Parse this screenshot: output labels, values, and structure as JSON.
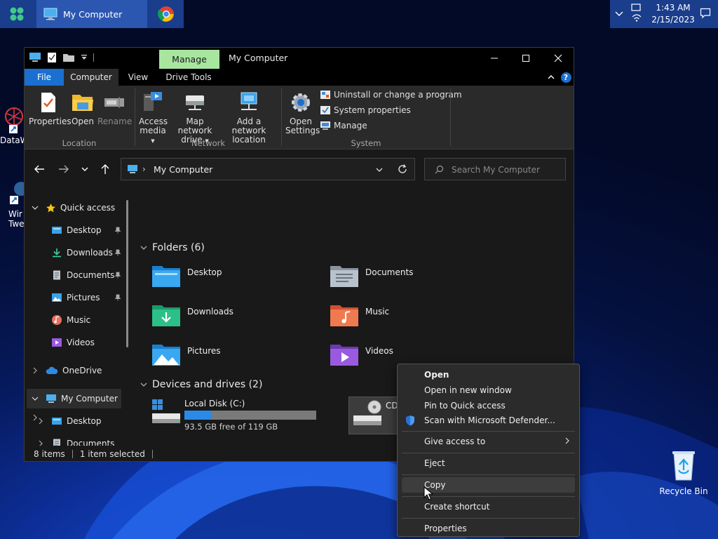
{
  "taskbar": {
    "start_label": "Start",
    "active_app": "My Computer",
    "time": "1:43 AM",
    "date": "2/15/2023"
  },
  "desktop": {
    "recycle_bin": "Recycle Bin",
    "partial_icon_1": "DataW",
    "partial_icon_2_line1": "Wir",
    "partial_icon_2_line2": "Twe"
  },
  "window": {
    "manage_tab": "Manage",
    "title": "My Computer",
    "tabs": [
      "File",
      "Computer",
      "View",
      "Drive Tools"
    ]
  },
  "ribbon": {
    "location": {
      "label": "Location",
      "properties": "Properties",
      "open": "Open",
      "rename": "Rename"
    },
    "network": {
      "label": "Network",
      "access_media_1": "Access",
      "access_media_2": "media",
      "map_drive_1": "Map network",
      "map_drive_2": "drive",
      "add_location_1": "Add a network",
      "add_location_2": "location"
    },
    "system": {
      "label": "System",
      "open_settings_1": "Open",
      "open_settings_2": "Settings",
      "uninstall": "Uninstall or change a program",
      "system_properties": "System properties",
      "manage": "Manage"
    }
  },
  "address": {
    "path": "My Computer",
    "search_placeholder": "Search My Computer"
  },
  "nav": {
    "quick_access": "Quick access",
    "items": [
      "Desktop",
      "Downloads",
      "Documents",
      "Pictures",
      "Music",
      "Videos"
    ],
    "onedrive": "OneDrive",
    "my_computer": "My Computer",
    "mc_children": [
      "Desktop",
      "Documents"
    ]
  },
  "content": {
    "folders_header": "Folders (6)",
    "folders": [
      "Desktop",
      "Documents",
      "Downloads",
      "Music",
      "Pictures",
      "Videos"
    ],
    "drives_header": "Devices and drives (2)",
    "local_disk": "Local Disk (C:)",
    "local_disk_free": "93.5 GB free of 119 GB",
    "local_disk_used_fraction": 0.21,
    "cd_drive": "CD Drive (D:)"
  },
  "status": {
    "items": "8 items",
    "selected": "1 item selected"
  },
  "context_menu": {
    "open": "Open",
    "open_new_window": "Open in new window",
    "pin_quick_access": "Pin to Quick access",
    "scan": "Scan with Microsoft Defender...",
    "give_access": "Give access to",
    "eject": "Eject",
    "copy": "Copy",
    "create_shortcut": "Create shortcut",
    "properties": "Properties"
  },
  "colors": {
    "accent": "#1a6fd0",
    "manage_tab": "#a8e6a0",
    "progress": "#2b8ae6"
  }
}
